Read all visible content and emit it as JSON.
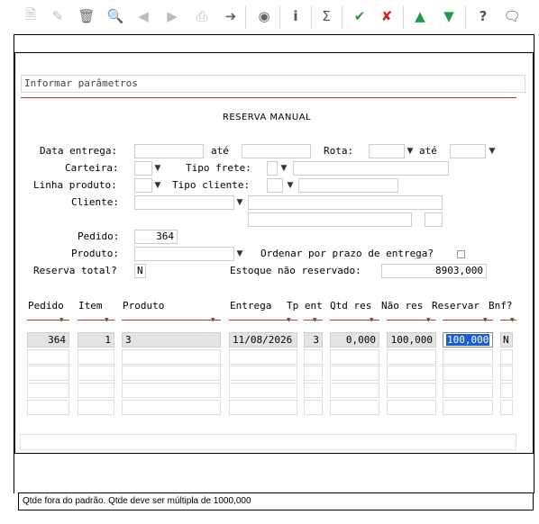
{
  "toolbar": {
    "icons": [
      "new-doc-icon",
      "edit-icon",
      "trash-icon",
      "search-icon",
      "prev-icon",
      "next-icon",
      "print-icon",
      "export-icon",
      "binoculars-icon",
      "info-icon",
      "sum-icon",
      "confirm-icon",
      "cancel-icon",
      "up-icon",
      "down-icon",
      "help-icon",
      "chat-icon"
    ],
    "help_label": "?",
    "info_label": "i",
    "sum_label": "Σ"
  },
  "params_label": "Informar parâmetros",
  "title": "RESERVA MANUAL",
  "form": {
    "data_entrega_label": "Data entrega:",
    "ate_label": "até",
    "rota_label": "Rota:",
    "ate2_label": "até",
    "carteira_label": "Carteira:",
    "tipo_frete_label": "Tipo frete:",
    "linha_produto_label": "Linha produto:",
    "tipo_cliente_label": "Tipo cliente:",
    "cliente_label": "Cliente:",
    "pedido_label": "Pedido:",
    "pedido_value": "364",
    "produto_label": "Produto:",
    "ordenar_label": "Ordenar por prazo de entrega?",
    "reserva_total_label": "Reserva total?",
    "reserva_total_value": "N",
    "estoque_label": "Estoque não reservado:",
    "estoque_value": "8903,000"
  },
  "grid": {
    "headers": [
      "Pedido",
      "Item",
      "Produto",
      "Entrega",
      "Tp ent",
      "Qtd res",
      "Não res",
      "Reservar",
      "Bnf?"
    ],
    "row": {
      "pedido": "364",
      "item": "1",
      "produto": "3",
      "entrega": "11/08/2026",
      "tp_ent": "3",
      "qtd_res": "0,000",
      "nao_res": "100,000",
      "reservar": "100,000",
      "bnf": "N"
    }
  },
  "status_message": "Qtde fora do padrão. Qtde deve ser múltipla de 1000,000",
  "colors": {
    "accent_line": "#c0392b",
    "selection": "#1a5fd1"
  }
}
